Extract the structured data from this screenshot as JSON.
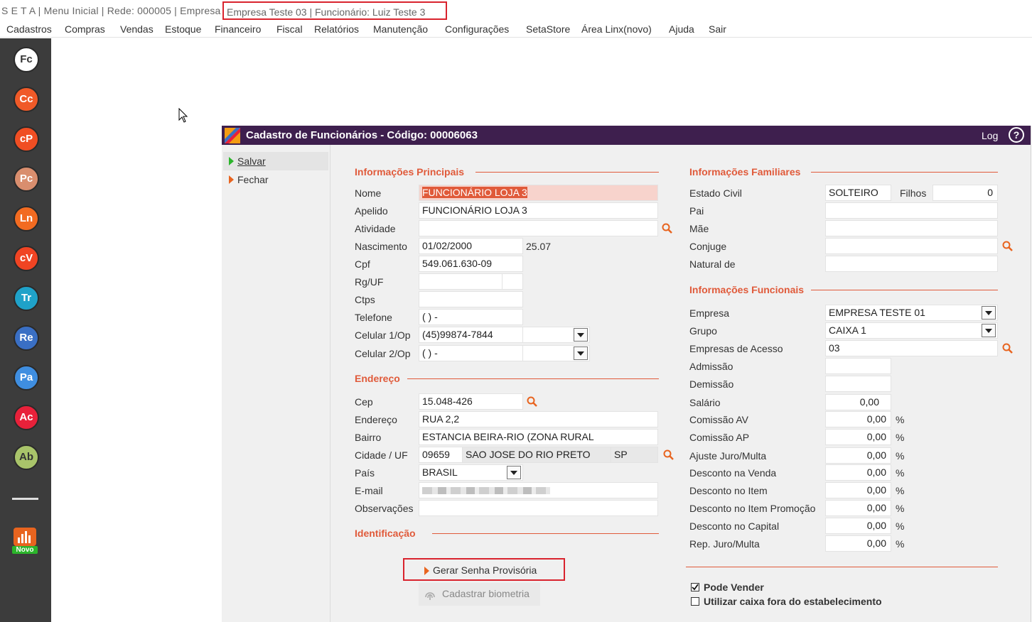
{
  "titlebar": {
    "prefix": "S E T A | Menu Inicial | Rede: 000005 | Empresa",
    "highlight": "Empresa Teste  03 | Funcionário: Luiz Teste 3"
  },
  "menu": [
    "Cadastros",
    "Compras",
    "Vendas",
    "Estoque",
    "Financeiro",
    "Fiscal",
    "Relatórios",
    "Manutenção",
    "Configurações",
    "SetaStore",
    "Área Linx(novo)",
    "Ajuda",
    "Sair"
  ],
  "leftbar": {
    "icons": [
      {
        "label": "Fc",
        "color": "#ffffff",
        "text": "#333333"
      },
      {
        "label": "Cc",
        "color": "#f05a28",
        "text": "#ffffff"
      },
      {
        "label": "cP",
        "color": "#f04e23",
        "text": "#ffffff"
      },
      {
        "label": "Pc",
        "color": "#d98e6e",
        "text": "#ffffff"
      },
      {
        "label": "Ln",
        "color": "#f26b21",
        "text": "#ffffff"
      },
      {
        "label": "cV",
        "color": "#f04423",
        "text": "#ffffff"
      },
      {
        "label": "Tr",
        "color": "#1fa2c9",
        "text": "#ffffff"
      },
      {
        "label": "Re",
        "color": "#3a6fc4",
        "text": "#ffffff"
      },
      {
        "label": "Pa",
        "color": "#3f8ee0",
        "text": "#ffffff"
      },
      {
        "label": "Ac",
        "color": "#e8213a",
        "text": "#ffffff"
      },
      {
        "label": "Ab",
        "color": "#a9c46a",
        "text": "#333333"
      }
    ],
    "novo_label": "Novo"
  },
  "window": {
    "title": "Cadastro de Funcionários - Código: 00006063",
    "log": "Log",
    "help": "?",
    "actions": {
      "salvar": "Salvar",
      "fechar": "Fechar"
    }
  },
  "principal": {
    "section": "Informações Principais",
    "labels": {
      "nome": "Nome",
      "apelido": "Apelido",
      "atividade": "Atividade",
      "nascimento": "Nascimento",
      "cpf": "Cpf",
      "rg": "Rg/UF",
      "ctps": "Ctps",
      "telefone": "Telefone",
      "celular1": "Celular 1/Op",
      "celular2": "Celular 2/Op"
    },
    "values": {
      "nome": "FUNCIONÁRIO LOJA 3",
      "apelido": "FUNCIONÁRIO LOJA 3",
      "atividade": "",
      "nascimento": "01/02/2000",
      "idade": "25.07",
      "cpf": "549.061.630-09",
      "rg": "",
      "uf": "",
      "ctps": "",
      "telefone": "( )   -",
      "celular1": "(45)99874-7844",
      "op1": "",
      "celular2": "( )    -",
      "op2": ""
    }
  },
  "endereco": {
    "section": "Endereço",
    "labels": {
      "cep": "Cep",
      "endereco": "Endereço",
      "bairro": "Bairro",
      "cidade": "Cidade / UF",
      "pais": "País",
      "email": "E-mail",
      "observacoes": "Observações"
    },
    "values": {
      "cep": "15.048-426",
      "endereco": "RUA 2,2",
      "bairro": "ESTANCIA BEIRA-RIO (ZONA RURAL",
      "codigo_cidade": "09659",
      "cidade": "SAO JOSE DO RIO PRETO",
      "uf": "SP",
      "pais": "BRASIL",
      "email": "",
      "observacoes": ""
    }
  },
  "identificacao": {
    "section": "Identificação",
    "gerar_senha": "Gerar Senha Provisória",
    "biometria": "Cadastrar biometria"
  },
  "familiares": {
    "section": "Informações Familiares",
    "labels": {
      "estado_civil": "Estado Civil",
      "filhos": "Filhos",
      "pai": "Pai",
      "mae": "Mãe",
      "conjuge": "Conjuge",
      "natural": "Natural de"
    },
    "values": {
      "estado_civil": "SOLTEIRO",
      "filhos": "0",
      "pai": "",
      "mae": "",
      "conjuge": "",
      "natural": ""
    }
  },
  "funcionais": {
    "section": "Informações Funcionais",
    "labels": {
      "empresa": "Empresa",
      "grupo": "Grupo",
      "empresas_acesso": "Empresas de Acesso",
      "admissao": "Admissão",
      "demissao": "Demissão",
      "salario": "Salário",
      "comissao_av": "Comissão AV",
      "comissao_ap": "Comissão AP",
      "ajuste": "Ajuste Juro/Multa",
      "desc_venda": "Desconto na Venda",
      "desc_item": "Desconto no Item",
      "desc_item_promo": "Desconto no Item Promoção",
      "desc_capital": "Desconto no Capital",
      "rep_juro": "Rep. Juro/Multa"
    },
    "values": {
      "empresa": "EMPRESA TESTE  01",
      "grupo": "CAIXA 1",
      "empresas_acesso": "03",
      "admissao": "",
      "demissao": "",
      "salario": "0,00",
      "comissao_av": "0,00",
      "comissao_ap": "0,00",
      "ajuste": "0,00",
      "desc_venda": "0,00",
      "desc_item": "0,00",
      "desc_item_promo": "0,00",
      "desc_capital": "0,00",
      "rep_juro": "0,00"
    },
    "percent": "%",
    "pode_vender": "Pode Vender",
    "utilizar_caixa": "Utilizar caixa fora do estabelecimento",
    "pode_vender_checked": true,
    "utilizar_caixa_checked": false
  }
}
